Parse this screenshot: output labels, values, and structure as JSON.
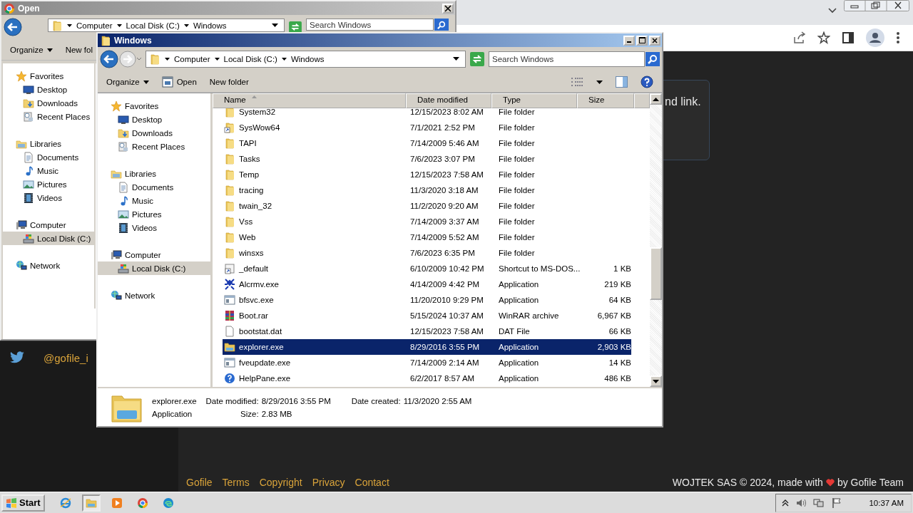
{
  "browser": {
    "card_text": "nd link.",
    "twitter_handle": "@gofile_i",
    "footer_links": [
      "Gofile",
      "Terms",
      "Copyright",
      "Privacy",
      "Contact"
    ],
    "credit_start": "WOJTEK SAS © 2024, made with",
    "credit_end": "by Gofile Team"
  },
  "open_dialog": {
    "title": "Open",
    "breadcrumb": [
      "Computer",
      "Local Disk (C:)",
      "Windows"
    ],
    "search": {
      "placeholder": "Search Windows"
    },
    "toolbar": [
      {
        "label": "Organize",
        "kind": "menu"
      },
      {
        "label": "New fol",
        "kind": "plain"
      }
    ],
    "nav": [
      {
        "label": "Favorites",
        "kind": "star",
        "selected": false,
        "children": [
          {
            "label": "Desktop",
            "kind": "desktop",
            "selected": false
          },
          {
            "label": "Downloads",
            "kind": "downloads",
            "selected": false
          },
          {
            "label": "Recent Places",
            "kind": "recent",
            "selected": false
          }
        ]
      },
      {
        "label": "Libraries",
        "kind": "libraries",
        "selected": false,
        "children": [
          {
            "label": "Documents",
            "kind": "documents",
            "selected": false
          },
          {
            "label": "Music",
            "kind": "music",
            "selected": false
          },
          {
            "label": "Pictures",
            "kind": "pictures",
            "selected": false
          },
          {
            "label": "Videos",
            "kind": "videos",
            "selected": false
          }
        ]
      },
      {
        "label": "Computer",
        "kind": "computer",
        "selected": false,
        "children": [
          {
            "label": "Local Disk (C:)",
            "kind": "disk",
            "selected": true
          }
        ]
      },
      {
        "label": "Network",
        "kind": "network",
        "selected": false
      }
    ]
  },
  "explorer": {
    "title": "Windows",
    "breadcrumb": [
      "Computer",
      "Local Disk (C:)",
      "Windows"
    ],
    "search": {
      "placeholder": "Search Windows"
    },
    "toolbar": [
      {
        "label": "Organize",
        "kind": "menu"
      },
      {
        "label": "Open",
        "kind": "open"
      },
      {
        "label": "New folder",
        "kind": "plain"
      }
    ],
    "nav": [
      {
        "label": "Favorites",
        "kind": "star",
        "selected": false,
        "children": [
          {
            "label": "Desktop",
            "kind": "desktop",
            "selected": false
          },
          {
            "label": "Downloads",
            "kind": "downloads",
            "selected": false
          },
          {
            "label": "Recent Places",
            "kind": "recent",
            "selected": false
          }
        ]
      },
      {
        "label": "Libraries",
        "kind": "libraries",
        "selected": false,
        "children": [
          {
            "label": "Documents",
            "kind": "documents",
            "selected": false
          },
          {
            "label": "Music",
            "kind": "music",
            "selected": false
          },
          {
            "label": "Pictures",
            "kind": "pictures",
            "selected": false
          },
          {
            "label": "Videos",
            "kind": "videos",
            "selected": false
          }
        ]
      },
      {
        "label": "Computer",
        "kind": "computer",
        "selected": false,
        "children": [
          {
            "label": "Local Disk (C:)",
            "kind": "disk",
            "selected": true
          }
        ]
      },
      {
        "label": "Network",
        "kind": "network",
        "selected": false
      }
    ],
    "columns": [
      {
        "label": "Name",
        "sorted": true
      },
      {
        "label": "Date modified",
        "sorted": false
      },
      {
        "label": "Type",
        "sorted": false
      },
      {
        "label": "Size",
        "sorted": false
      }
    ],
    "rows": [
      {
        "name": "System32",
        "date": "12/15/2023 8:02 AM",
        "type": "File folder",
        "kind": "folder",
        "selected": false
      },
      {
        "name": "SysWow64",
        "date": "7/1/2021 2:52 PM",
        "type": "File folder",
        "kind": "folder-shortcut",
        "selected": false
      },
      {
        "name": "TAPI",
        "date": "7/14/2009 5:46 AM",
        "type": "File folder",
        "kind": "folder",
        "selected": false
      },
      {
        "name": "Tasks",
        "date": "7/6/2023 3:07 PM",
        "type": "File folder",
        "kind": "folder",
        "selected": false
      },
      {
        "name": "Temp",
        "date": "12/15/2023 7:58 AM",
        "type": "File folder",
        "kind": "folder",
        "selected": false
      },
      {
        "name": "tracing",
        "date": "11/3/2020 3:18 AM",
        "type": "File folder",
        "kind": "folder",
        "selected": false
      },
      {
        "name": "twain_32",
        "date": "11/2/2020 9:20 AM",
        "type": "File folder",
        "kind": "folder",
        "selected": false
      },
      {
        "name": "Vss",
        "date": "7/14/2009 3:37 AM",
        "type": "File folder",
        "kind": "folder",
        "selected": false
      },
      {
        "name": "Web",
        "date": "7/14/2009 5:52 AM",
        "type": "File folder",
        "kind": "folder",
        "selected": false
      },
      {
        "name": "winsxs",
        "date": "7/6/2023 6:35 PM",
        "type": "File folder",
        "kind": "folder",
        "selected": false
      },
      {
        "name": "_default",
        "date": "6/10/2009 10:42 PM",
        "type": "Shortcut to MS-DOS...",
        "size": "1 KB",
        "kind": "shortcut",
        "selected": false
      },
      {
        "name": "Alcrmv.exe",
        "date": "4/14/2009 4:42 PM",
        "type": "Application",
        "size": "219 KB",
        "kind": "app-bug",
        "selected": false
      },
      {
        "name": "bfsvc.exe",
        "date": "11/20/2010 9:29 PM",
        "type": "Application",
        "size": "64 KB",
        "kind": "app-window",
        "selected": false
      },
      {
        "name": "Boot.rar",
        "date": "5/15/2024 10:37 AM",
        "type": "WinRAR archive",
        "size": "6,967 KB",
        "kind": "rar",
        "selected": false
      },
      {
        "name": "bootstat.dat",
        "date": "12/15/2023 7:58 AM",
        "type": "DAT File",
        "size": "66 KB",
        "kind": "file",
        "selected": false
      },
      {
        "name": "explorer.exe",
        "date": "8/29/2016 3:55 PM",
        "type": "Application",
        "size": "2,903 KB",
        "kind": "explorer",
        "selected": true
      },
      {
        "name": "fveupdate.exe",
        "date": "7/14/2009 2:14 AM",
        "type": "Application",
        "size": "14 KB",
        "kind": "app-window",
        "selected": false
      },
      {
        "name": "HelpPane.exe",
        "date": "6/2/2017 8:57 AM",
        "type": "Application",
        "size": "486 KB",
        "kind": "help",
        "selected": false
      }
    ],
    "details": {
      "name": "explorer.exe",
      "type": "Application",
      "field_columns": [
        [
          {
            "label": "Date modified:",
            "value": "8/29/2016 3:55 PM"
          },
          {
            "label": "Size:",
            "value": "2.83 MB"
          }
        ],
        [
          {
            "label": "Date created:",
            "value": "11/3/2020 2:55 AM"
          }
        ]
      ]
    }
  },
  "taskbar": {
    "start": "Start",
    "apps": [
      {
        "kind": "ie",
        "active": false
      },
      {
        "kind": "explorer",
        "active": true
      },
      {
        "kind": "media",
        "active": false
      },
      {
        "kind": "chrome",
        "active": false
      },
      {
        "kind": "edge",
        "active": false
      }
    ],
    "clock": "10:37 AM"
  }
}
